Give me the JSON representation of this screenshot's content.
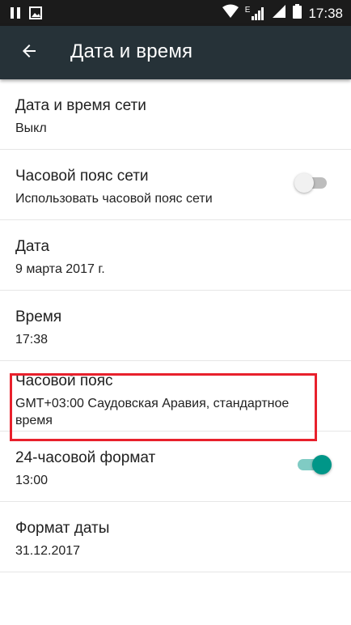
{
  "status_bar": {
    "time": "17:38",
    "icons": [
      "pause-icon",
      "image-icon",
      "wifi-icon",
      "signal-e-icon",
      "signal-icon",
      "battery-icon"
    ],
    "network_label": "E"
  },
  "header": {
    "title": "Дата и время",
    "back_icon": "arrow-back-icon",
    "background": "#263238"
  },
  "settings": {
    "network_datetime": {
      "title": "Дата и время сети",
      "summary": "Выкл"
    },
    "network_timezone": {
      "title": "Часовой пояс сети",
      "summary": "Использовать часовой пояс сети",
      "enabled": false
    },
    "date": {
      "title": "Дата",
      "summary": "9 марта 2017 г."
    },
    "time": {
      "title": "Время",
      "summary": "17:38"
    },
    "timezone": {
      "title": "Часовой пояс",
      "summary": "GMT+03:00 Саудовская Аравия, стандартное время",
      "highlighted": true
    },
    "format_24h": {
      "title": "24-часовой формат",
      "summary": "13:00",
      "enabled": true
    },
    "date_format": {
      "title": "Формат даты",
      "summary": "31.12.2017"
    }
  },
  "colors": {
    "accent": "#009688",
    "highlight": "#e8202c"
  }
}
